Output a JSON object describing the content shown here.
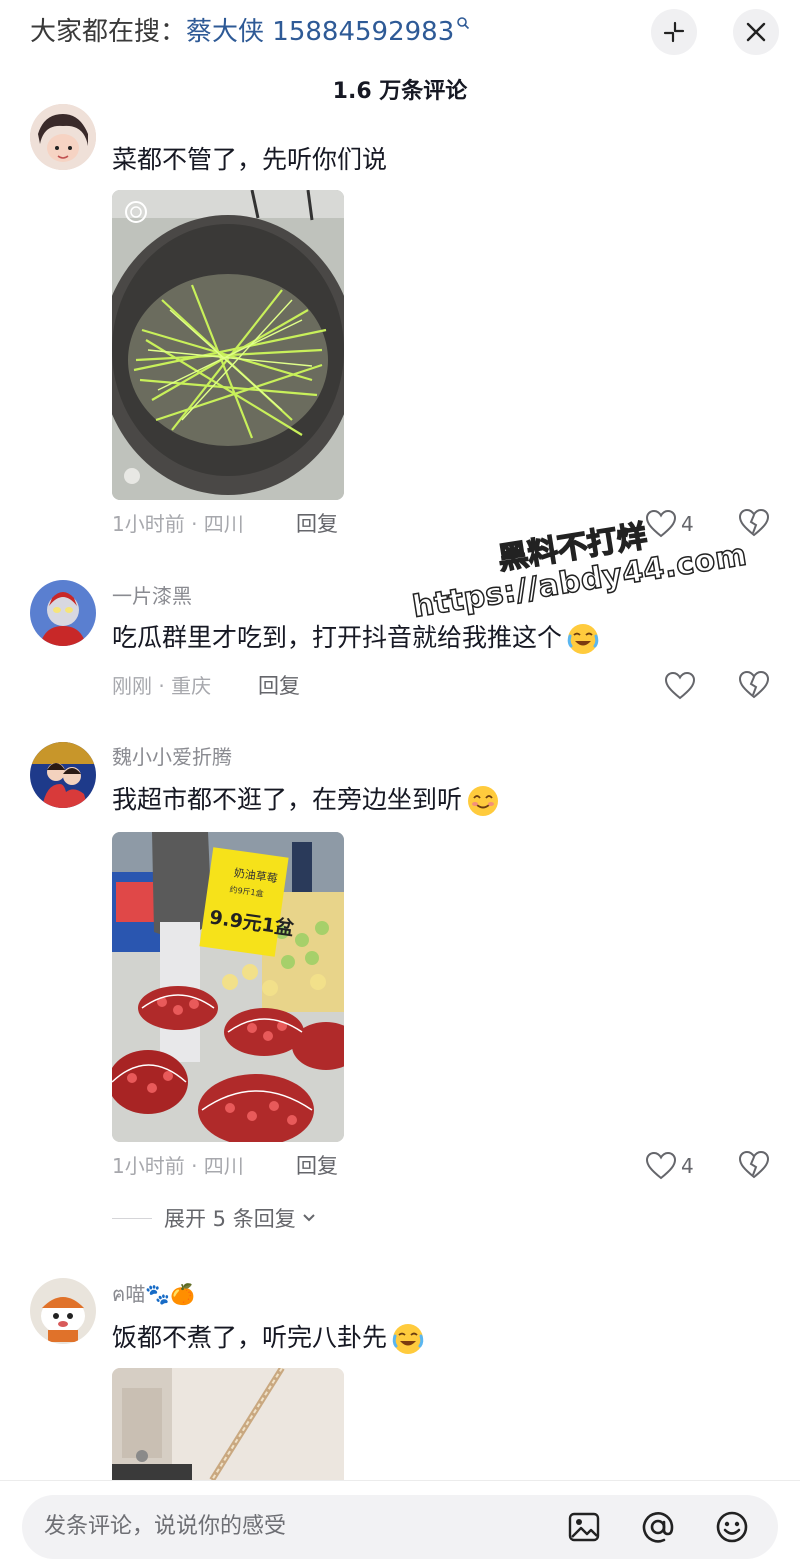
{
  "header": {
    "search_prefix": "大家都在搜：",
    "search_keyword": "蔡大侠 15884592983",
    "comment_count": "1.6 万条评论"
  },
  "comments": [
    {
      "username": "",
      "text": "菜都不管了，先听你们说",
      "time_location": "1小时前 · 四川",
      "reply_label": "回复",
      "like_count": "4",
      "image_description": "wok with shredded green vegetables"
    },
    {
      "username": "一片漆黑",
      "text": "吃瓜群里才吃到，打开抖音就给我推这个",
      "time_location": "刚刚 · 重庆",
      "reply_label": "回复",
      "like_count": ""
    },
    {
      "username": "魏小小爱折腾",
      "text": "我超市都不逛了，在旁边坐到听",
      "time_location": "1小时前 · 四川",
      "reply_label": "回复",
      "like_count": "4",
      "expand_replies": "展开 5 条回复"
    },
    {
      "username": "ฅ喵🐾🍊",
      "text": "饭都不煮了，听完八卦先"
    }
  ],
  "supermarket_sign": {
    "line1": "奶油草莓",
    "line2": "约9斤1盒",
    "price": "9.9元1盆"
  },
  "watermark": {
    "line1": "黑料不打烊",
    "line2": "https://abdy44.com"
  },
  "composer": {
    "placeholder": "发条评论，说说你的感受"
  },
  "icons": {
    "search_hint": "search-icon",
    "collapse": "collapse-icon",
    "close": "close-icon",
    "like": "heart-icon",
    "dislike": "broken-heart-icon",
    "image": "image-icon",
    "mention": "at-icon",
    "emoji": "emoji-icon"
  },
  "colors": {
    "search_keyword": "#2e5a96",
    "meta_text": "#a7a8ad",
    "primary_text": "#161823"
  }
}
